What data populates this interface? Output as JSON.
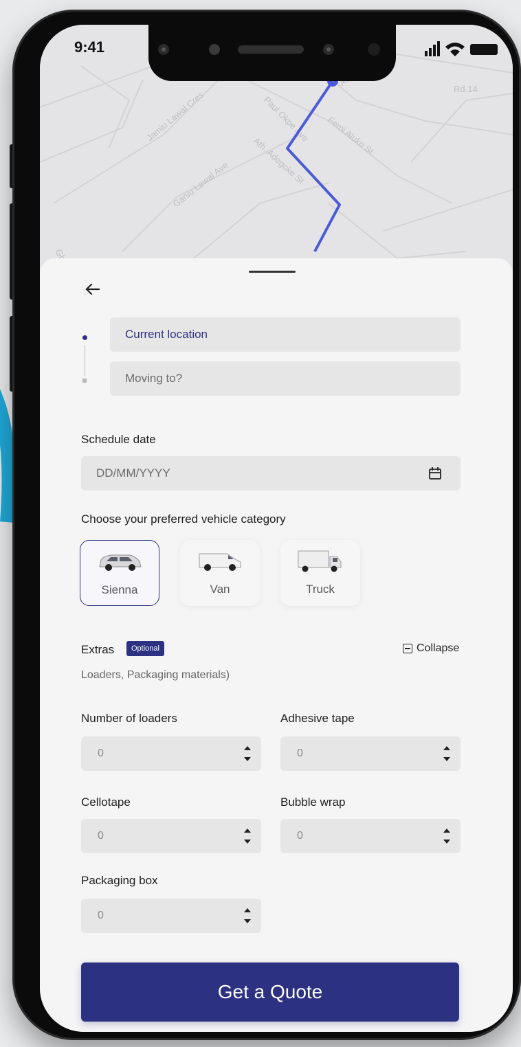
{
  "status": {
    "time": "9:41"
  },
  "map": {
    "streets": [
      "Jamiu Lawal Cres",
      "Paul Okpe Ave",
      "Femi Aluko St",
      "Ath. Adegoke St",
      "Ganiu Lawal Ave",
      "Rd.14",
      "Ave",
      "Gb"
    ]
  },
  "route": {
    "from_placeholder": "Current location",
    "to_placeholder": "Moving to?"
  },
  "schedule": {
    "label": "Schedule date",
    "placeholder": "DD/MM/YYYY"
  },
  "vehicles": {
    "label": "Choose your preferred vehicle category",
    "items": [
      {
        "label": "Sienna",
        "selected": true
      },
      {
        "label": "Van",
        "selected": false
      },
      {
        "label": "Truck",
        "selected": false
      }
    ]
  },
  "extras": {
    "label": "Extras",
    "badge": "Optional",
    "collapse_label": "Collapse",
    "description": "Loaders, Packaging materials)",
    "fields": [
      {
        "label": "Number of loaders",
        "value": "0"
      },
      {
        "label": "Adhesive tape",
        "value": "0"
      },
      {
        "label": "Cellotape",
        "value": "0"
      },
      {
        "label": "Bubble wrap",
        "value": "0"
      },
      {
        "label": "Packaging box",
        "value": "0"
      }
    ]
  },
  "cta": {
    "label": "Get a Quote"
  },
  "colors": {
    "accent": "#2d3182",
    "route": "#4b5bd6"
  }
}
